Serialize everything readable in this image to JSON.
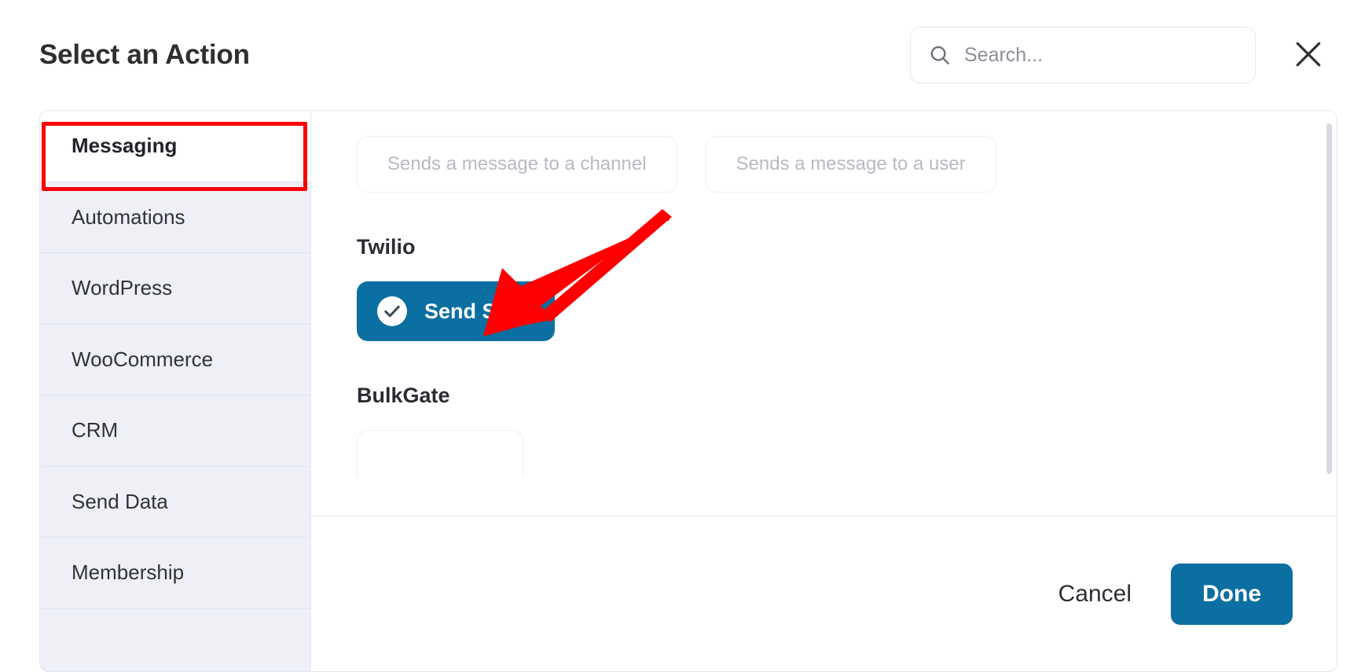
{
  "header": {
    "title": "Select an Action",
    "search": {
      "value": "",
      "placeholder": "Search...",
      "icon": "search-icon"
    },
    "close": {
      "icon": "close-icon",
      "label": "Close"
    }
  },
  "sidebar": {
    "items": [
      {
        "label": "Messaging",
        "selected": true
      },
      {
        "label": "Automations",
        "selected": false
      },
      {
        "label": "WordPress",
        "selected": false
      },
      {
        "label": "WooCommerce",
        "selected": false
      },
      {
        "label": "CRM",
        "selected": false
      },
      {
        "label": "Send Data",
        "selected": false
      },
      {
        "label": "Membership",
        "selected": false
      }
    ]
  },
  "content": {
    "top_chips": [
      {
        "label": "Sends a message to a channel"
      },
      {
        "label": "Sends a message to a user"
      }
    ],
    "groups": [
      {
        "title": "Twilio",
        "actions": [
          {
            "label": "Send SMS",
            "selected": true,
            "icon": "check-circle-icon"
          }
        ]
      },
      {
        "title": "BulkGate",
        "actions": []
      }
    ]
  },
  "footer": {
    "cancel_label": "Cancel",
    "done_label": "Done"
  },
  "annotations": {
    "highlight_box_target": "sidebar-item-messaging",
    "arrow_target": "send-sms-action",
    "color": "#fe0000"
  },
  "colors": {
    "accent_blue": "#0b6fa2",
    "annotation_red": "#fe0000",
    "sidebar_bg": "#eef0f6",
    "border": "#e4e6f0",
    "muted_text": "#b9b9c4"
  }
}
